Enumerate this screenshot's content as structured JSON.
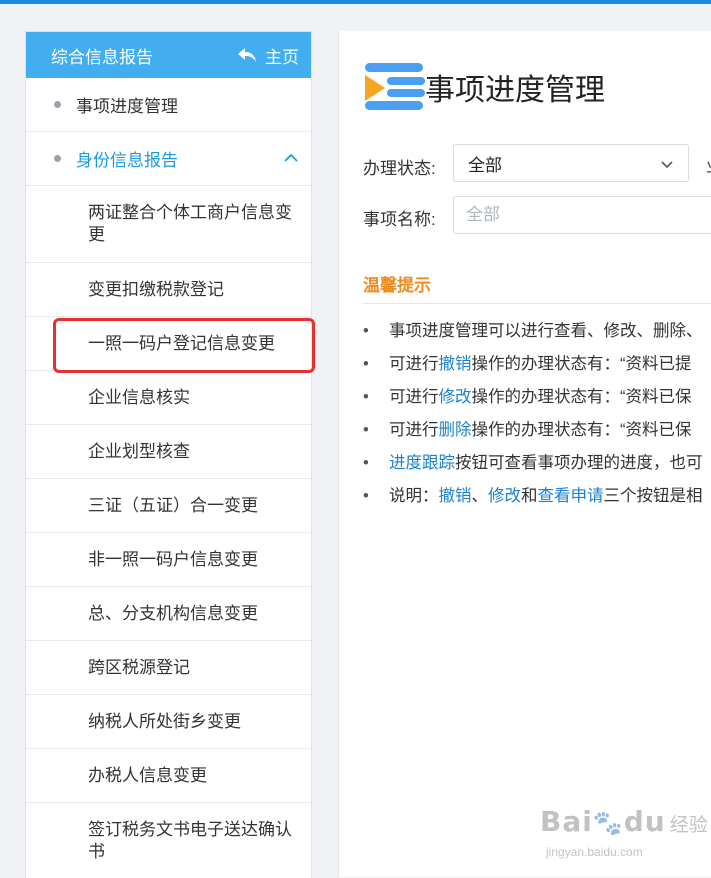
{
  "sidebar": {
    "header_title": "综合信息报告",
    "home_label": "主页",
    "section_1": "事项进度管理",
    "section_2": "身份信息报告",
    "items": [
      "两证整合个体工商户信息变更",
      "变更扣缴税款登记",
      "一照一码户登记信息变更",
      "企业信息核实",
      "企业划型核查",
      "三证（五证）合一变更",
      "非一照一码户信息变更",
      "总、分支机构信息变更",
      "跨区税源登记",
      "纳税人所处街乡变更",
      "办税人信息变更",
      "签订税务文书电子送达确认书"
    ]
  },
  "main": {
    "title": "事项进度管理",
    "status_label": "办理状态:",
    "status_value": "全部",
    "status_options": [
      "全部"
    ],
    "name_label": "事项名称:",
    "name_placeholder": "全部",
    "truncated_fragment": "业",
    "tips_title": "温馨提示",
    "tips": [
      {
        "a": "事项进度管理可以进行查看、修改、删除、"
      },
      {
        "a": "可进行",
        "link": "撤销",
        "b": "操作的办理状态有：“资料已提"
      },
      {
        "a": "可进行",
        "link": "修改",
        "b": "操作的办理状态有：“资料已保"
      },
      {
        "a": "可进行",
        "link": "删除",
        "b": "操作的办理状态有：“资料已保"
      },
      {
        "link": "进度跟踪",
        "b": "按钮可查看事项办理的进度，也可"
      },
      {
        "a": "说明：",
        "link": "撤销",
        "b": "、",
        "link2": "修改",
        "c": "和",
        "link3": "查看申请",
        "d": "三个按钮是相"
      }
    ]
  },
  "watermark": {
    "logo": "Bai",
    "logo_tail": "du",
    "text": "经验",
    "url": "jingyan.baidu.com"
  },
  "colors": {
    "accent": "#42aef0",
    "link": "#1a82d0",
    "tips_title": "#f08c1e",
    "annotation": "#e53030"
  }
}
